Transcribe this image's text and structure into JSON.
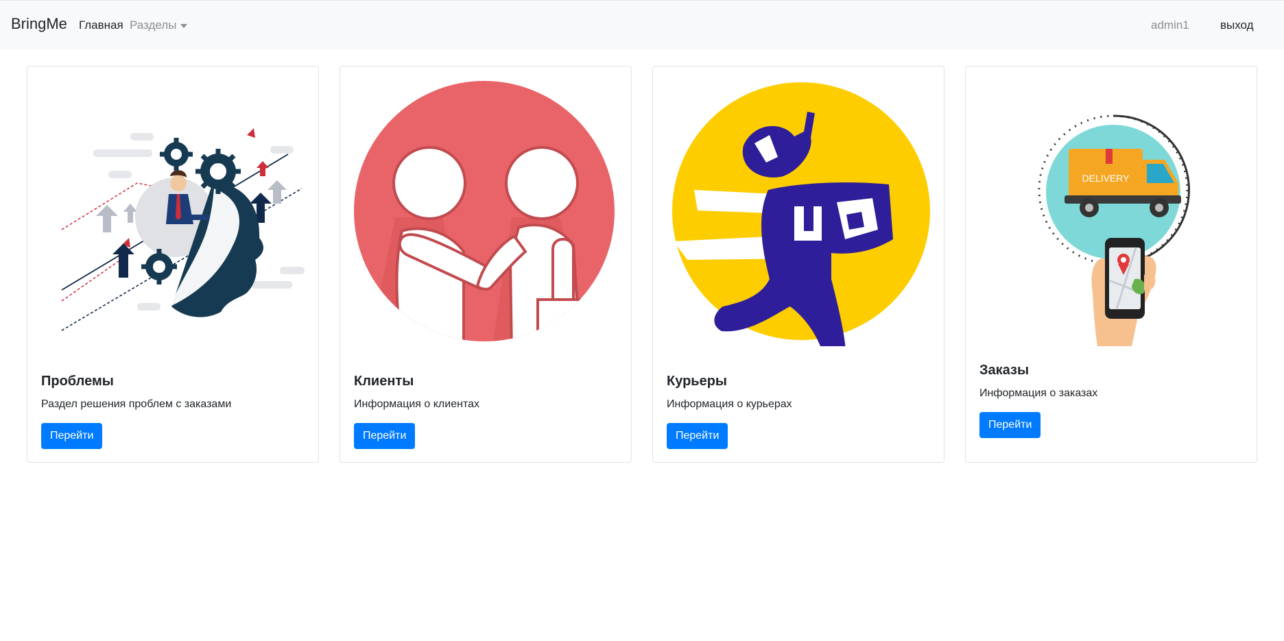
{
  "navbar": {
    "brand": "BringMe",
    "home": "Главная",
    "sections": "Разделы",
    "user": "admin1",
    "logout": "выход"
  },
  "cards": [
    {
      "title": "Проблемы",
      "text": "Раздел решения проблем с заказами",
      "button": "Перейти",
      "image_icon": "head-gears-illustration"
    },
    {
      "title": "Клиенты",
      "text": "Информация о клиентах",
      "button": "Перейти",
      "image_icon": "handshake-illustration"
    },
    {
      "title": "Курьеры",
      "text": "Информация о курьерах",
      "button": "Перейти",
      "image_icon": "running-courier-illustration"
    },
    {
      "title": "Заказы",
      "text": "Информация о заказах",
      "button": "Перейти",
      "image_icon": "delivery-truck-phone-illustration"
    }
  ],
  "colors": {
    "primary": "#007bff",
    "navbar_bg": "#f8f9fa",
    "handshake_bg": "#e96468",
    "courier_bg": "#fecd00",
    "courier_figure": "#2e1e9a",
    "delivery_circle": "#7fd8d8",
    "truck": "#f5a623"
  },
  "delivery_truck_text": "DELIVERY"
}
